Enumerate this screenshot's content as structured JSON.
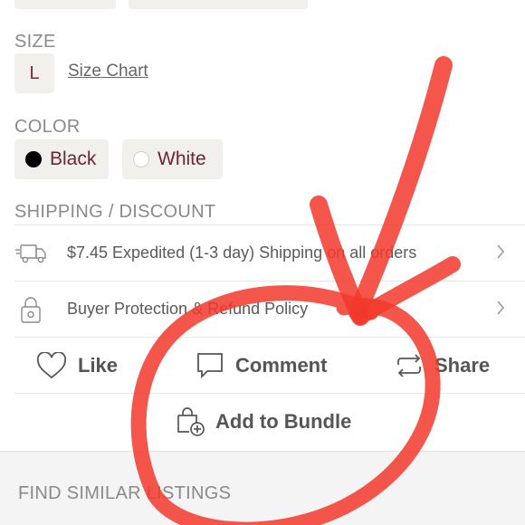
{
  "size": {
    "section_label": "SIZE",
    "selected": "L",
    "chart_link": "Size Chart"
  },
  "color": {
    "section_label": "COLOR",
    "options": [
      {
        "label": "Black",
        "swatch": "#000000"
      },
      {
        "label": "White",
        "swatch": "#ffffff"
      }
    ]
  },
  "shipping": {
    "section_label": "SHIPPING / DISCOUNT",
    "rows": [
      {
        "icon": "truck-icon",
        "text": "$7.45 Expedited (1-3 day) Shipping on all orders"
      },
      {
        "icon": "lock-icon",
        "text": "Buyer Protection & Refund Policy"
      }
    ]
  },
  "actions": {
    "like": "Like",
    "comment": "Comment",
    "share": "Share",
    "bundle": "Add to Bundle"
  },
  "footer": {
    "section_label": "FIND SIMILAR LISTINGS"
  },
  "colors": {
    "accent": "#6e2530",
    "annotation": "#f2382c",
    "chip_bg": "#f2f0ed"
  }
}
